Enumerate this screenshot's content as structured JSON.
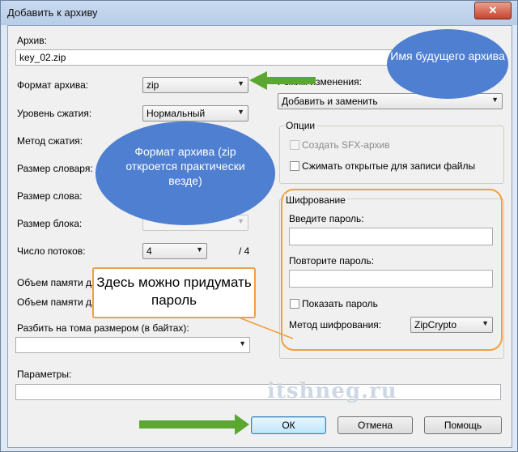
{
  "window": {
    "title": "Добавить к архиву",
    "close_glyph": "✕"
  },
  "archive": {
    "label": "Архив:",
    "value": "key_02.zip"
  },
  "left": {
    "format_label": "Формат архива:",
    "format_value": "zip",
    "level_label": "Уровень сжатия:",
    "level_value": "Нормальный",
    "method_label": "Метод сжатия:",
    "dict_label": "Размер словаря:",
    "word_label": "Размер слова:",
    "block_label": "Размер блока:",
    "threads_label": "Число потоков:",
    "threads_value": "4",
    "threads_max": "/ 4",
    "mem_pack_label": "Объем памяти для упаковки:",
    "mem_unpack_label": "Объем памяти для распаковки:",
    "split_label": "Разбить на тома размером (в байтах):",
    "params_label": "Параметры:"
  },
  "right": {
    "update_label": "Режим изменения:",
    "update_value": "Добавить и заменить",
    "options_title": "Опции",
    "sfx_label": "Создать SFX-архив",
    "shared_label": "Сжимать открытые для записи файлы",
    "encryption_title": "Шифрование",
    "password_label": "Введите пароль:",
    "repeat_label": "Повторите пароль:",
    "show_label": "Показать пароль",
    "enc_method_label": "Метод шифрования:",
    "enc_method_value": "ZipCrypto"
  },
  "buttons": {
    "ok": "ОК",
    "cancel": "Отмена",
    "help": "Помощь"
  },
  "annotations": {
    "cloud_name": "Имя будущего архива",
    "cloud_format": "Формат архива (zip откроется практически везде)",
    "callout_password": "Здесь можно придумать пароль"
  },
  "watermark": "itshneg.ru",
  "colors": {
    "cloud": "#4f7fd0",
    "callout_border": "#f0a040",
    "arrow": "#5aa832"
  },
  "icons": {
    "combo_arrow": "chevron-down-icon",
    "close": "close-icon"
  }
}
